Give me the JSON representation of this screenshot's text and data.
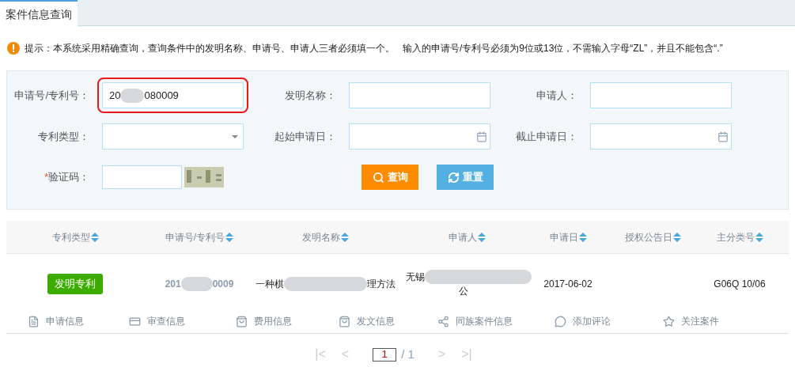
{
  "tabs": [
    {
      "label": "案件信息查询",
      "selected": true
    }
  ],
  "notice": {
    "part1": "提示：本系统采用精确查询，查询条件中的发明名称、申请号、申请人三者必须填一个。",
    "part2": "输入的申请号/专利号必须为9位或13位，不需输入字母“ZL”，并且不能包含“.”"
  },
  "form": {
    "fields": [
      {
        "kind": "text",
        "label": "申请号/专利号：",
        "value_start": "20",
        "value_end": "080009",
        "highlighted": true
      },
      {
        "kind": "text",
        "label": "发明名称：",
        "highlighted": false
      },
      {
        "kind": "text",
        "label": "申请人：",
        "highlighted": false
      },
      {
        "kind": "select",
        "label": "专利类型：",
        "highlighted": false
      },
      {
        "kind": "date",
        "label": "起始申请日：",
        "highlighted": false
      },
      {
        "kind": "date",
        "label": "截止申请日：",
        "highlighted": false
      }
    ],
    "captcha": {
      "required_mark": "*",
      "label": "验证码："
    },
    "buttons": [
      {
        "kind": "search",
        "label": "查询"
      },
      {
        "kind": "reset",
        "label": "重置"
      }
    ]
  },
  "table": {
    "columns": [
      "专利类型",
      "申请号/专利号",
      "发明名称",
      "申请人",
      "申请日",
      "授权公告日",
      "主分类号"
    ],
    "rows": [
      {
        "type_badge": "发明专利",
        "number_start": "201",
        "number_end": "0009",
        "name_start": "一种棋",
        "name_end": "理方法",
        "applicant_start": "无锡",
        "applicant_end": "公",
        "filing_date": "2017-06-02",
        "class_no": "G06Q 10/06",
        "actions": [
          {
            "kind": "doc",
            "label": "申请信息"
          },
          {
            "kind": "card",
            "label": "审查信息"
          },
          {
            "kind": "bag",
            "label": "费用信息"
          },
          {
            "kind": "bag",
            "label": "发文信息"
          },
          {
            "kind": "share",
            "label": "同族案件信息"
          },
          {
            "kind": "comment",
            "label": "添加评论"
          },
          {
            "kind": "star",
            "label": "关注案件"
          }
        ]
      }
    ]
  },
  "pagination": {
    "first": "|<",
    "prev": "<",
    "page": "1",
    "total": "/ 1",
    "next": ">",
    "last": ">|"
  }
}
